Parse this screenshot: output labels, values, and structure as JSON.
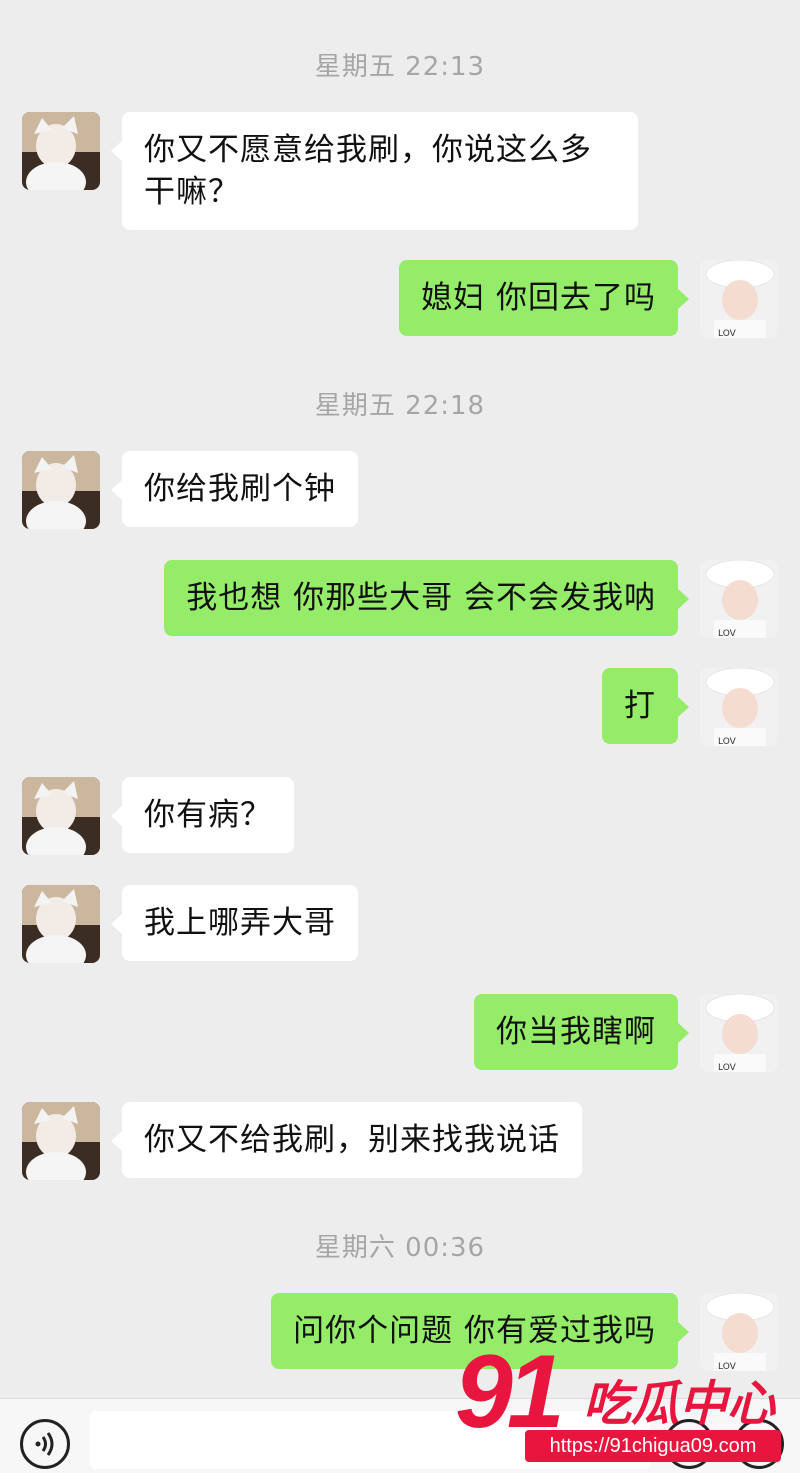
{
  "timestamps": [
    "星期五 22:13",
    "星期五 22:18",
    "星期六 00:36"
  ],
  "messages": [
    {
      "side": "in",
      "text": "你又不愿意给我刷，你说这么多干嘛？"
    },
    {
      "side": "out",
      "text": "媳妇 你回去了吗"
    },
    {
      "side": "in",
      "text": "你给我刷个钟"
    },
    {
      "side": "out",
      "text": "我也想 你那些大哥 会不会发我呐"
    },
    {
      "side": "out",
      "text": "打"
    },
    {
      "side": "in",
      "text": "你有病？"
    },
    {
      "side": "in",
      "text": "我上哪弄大哥"
    },
    {
      "side": "out",
      "text": "你当我瞎啊"
    },
    {
      "side": "in",
      "text": "你又不给我刷，别来找我说话"
    },
    {
      "side": "out",
      "text": "问你个问题 你有爱过我吗"
    }
  ],
  "input_bar": {
    "voice_icon": "voice-icon",
    "emoji_icon": "emoji-icon",
    "plus_icon": "plus-icon"
  },
  "watermark": {
    "number": "91",
    "name": "吃瓜中心",
    "url": "https://91chigua09.com"
  },
  "colors": {
    "background": "#ededed",
    "incoming_bubble": "#ffffff",
    "outgoing_bubble": "#95ec69",
    "timestamp": "#a6a6a6",
    "watermark": "#e8163f"
  }
}
